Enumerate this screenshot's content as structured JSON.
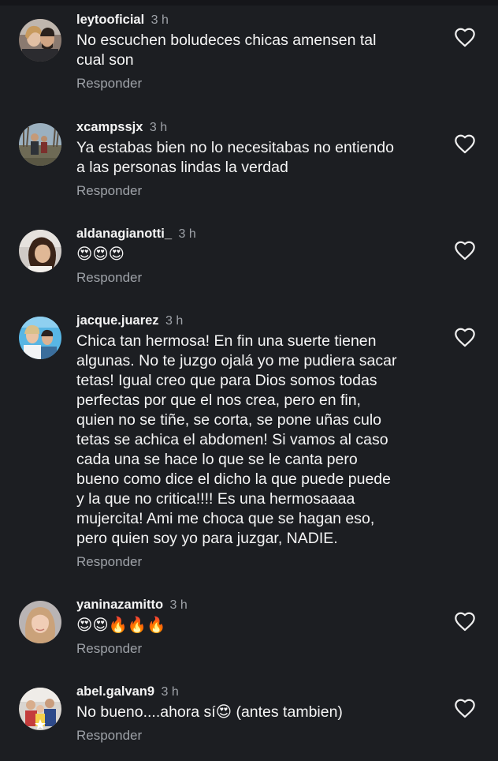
{
  "comments": [
    {
      "username": "leytooficial",
      "time": "3 h",
      "text": "No escuchen boludeces chicas amensen tal\ncual son",
      "reply": "Responder",
      "avatar_icon": "avatar-couple-photo"
    },
    {
      "username": "xcampssjx",
      "time": "3 h",
      "text": "Ya estabas bien no lo necesitabas no entiendo\na las personas lindas la verdad",
      "reply": "Responder",
      "avatar_icon": "avatar-outdoor-photo"
    },
    {
      "username": "aldanagianotti_",
      "time": "3 h",
      "text": "😍😍😍",
      "reply": "Responder",
      "avatar_icon": "avatar-portrait-photo"
    },
    {
      "username": "jacque.juarez",
      "time": "3 h",
      "text": "Chica tan hermosa! En fin una suerte tienen\nalgunas. No te juzgo ojalá yo me pudiera sacar\ntetas! Igual creo que para Dios somos todas\nperfectas por que el nos crea, pero en fin,\nquien no se tiñe, se corta, se pone uñas culo\ntetas se achica el abdomen! Si vamos al caso\ncada una se hace lo que se le canta pero\nbueno como dice el dicho la que puede puede\ny la que no critica!!!! Es una hermosaaaa\nmujercita! Ami me choca que se hagan eso,\npero quien soy yo para juzgar, NADIE.",
      "reply": "Responder",
      "avatar_icon": "avatar-group-photo"
    },
    {
      "username": "yaninazamitto",
      "time": "3 h",
      "text": "😍😍🔥🔥🔥",
      "reply": "Responder",
      "avatar_icon": "avatar-selfie-photo"
    },
    {
      "username": "abel.galvan9",
      "time": "3 h",
      "text": "No bueno....ahora sí😍 (antes tambien)",
      "reply": "Responder",
      "avatar_icon": "avatar-family-photo"
    }
  ],
  "like_icon": "heart-outline-icon",
  "colors": {
    "background": "#1c1e22",
    "text": "#f5f5f5",
    "muted": "#9ea2a8"
  }
}
